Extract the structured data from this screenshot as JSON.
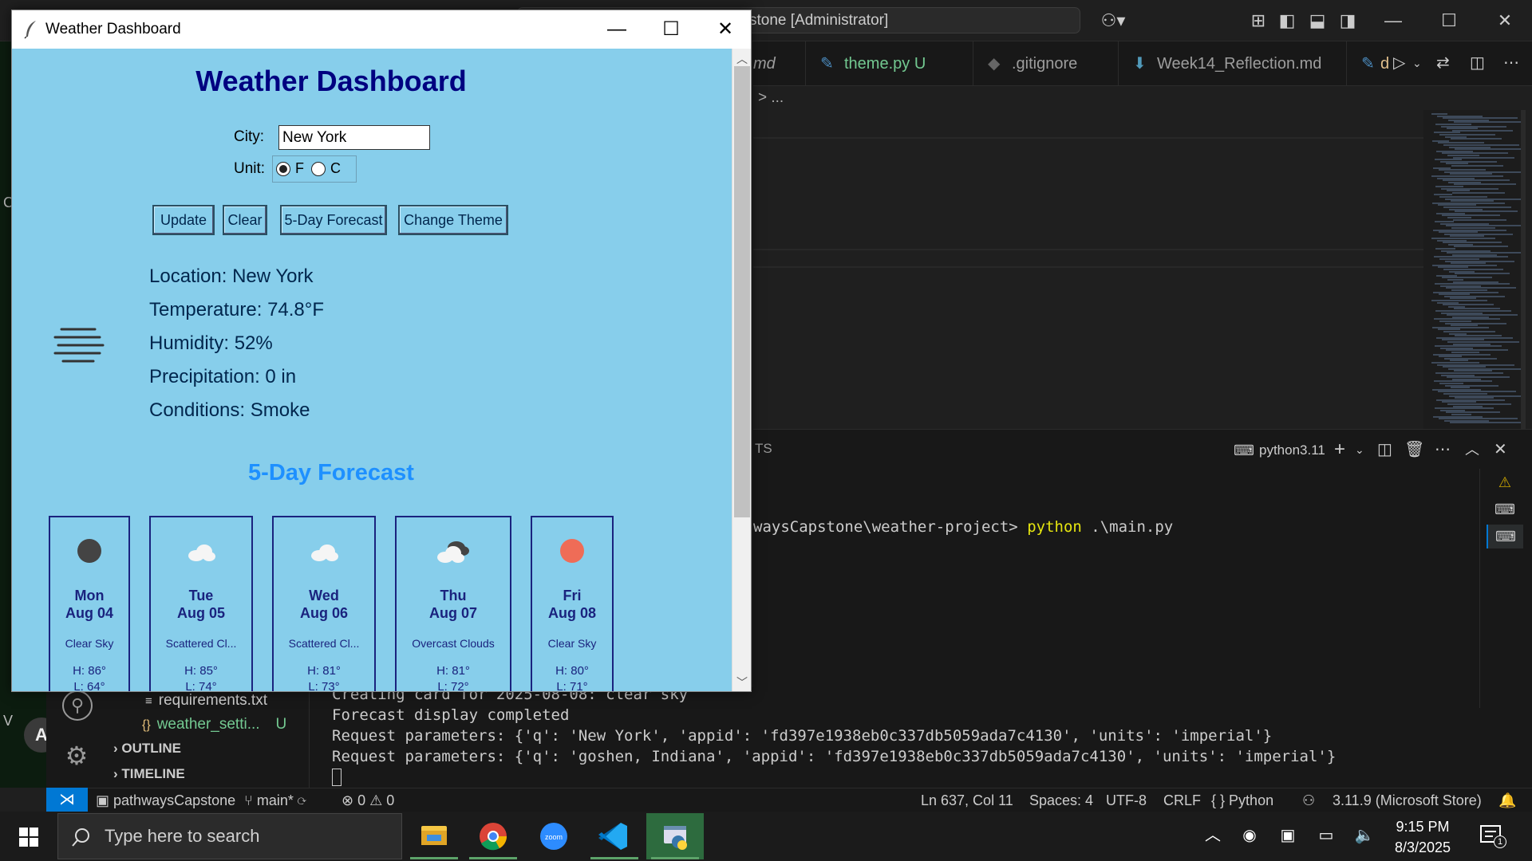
{
  "vscode": {
    "window_title": "stone [Administrator]",
    "tabs": [
      {
        "label": "md",
        "suffix": ""
      },
      {
        "label": "theme.py",
        "suffix": "U"
      },
      {
        "label": ".gitignore",
        "suffix": ""
      },
      {
        "label": "Week14_Reflection.md",
        "suffix": ""
      },
      {
        "label": "d",
        "suffix": ""
      }
    ],
    "breadcrumb": "> ...",
    "panel_tab": "TS",
    "terminal_name": "python3.11",
    "terminal": {
      "prompt_tail": "waysCapstone\\weather-project>",
      "command": "python",
      "command_arg": ".\\main.py",
      "lines": [
        "Creating card for 2025-08-08: clear sky",
        "Forecast display completed",
        "Request parameters: {'q': 'New York', 'appid': 'fd397e1938eb0c337db5059ada7c4130', 'units': 'imperial'}",
        "Request parameters: {'q': 'goshen, Indiana', 'appid': 'fd397e1938eb0c337db5059ada7c4130', 'units': 'imperial'}"
      ]
    },
    "explorer": {
      "files": [
        {
          "icon": "≡",
          "name": "requirements.txt",
          "status": ""
        },
        {
          "icon": "{}",
          "name": "weather_setti...",
          "status": "U"
        }
      ],
      "sections": [
        "OUTLINE",
        "TIMELINE"
      ]
    },
    "left_edge": {
      "top": "C",
      "bottom": "V",
      "badge": "A"
    },
    "statusbar": {
      "repo": "pathwaysCapstone",
      "branch": "main*",
      "errors": "0",
      "warnings": "0",
      "position": "Ln 637, Col 11",
      "spaces": "Spaces: 4",
      "encoding": "UTF-8",
      "eol": "CRLF",
      "language": "Python",
      "interpreter": "3.11.9 (Microsoft Store)"
    }
  },
  "taskbar": {
    "search_placeholder": "Type here to search",
    "time": "9:15 PM",
    "date": "8/3/2025",
    "notifications": "1"
  },
  "weather_window": {
    "title": "Weather Dashboard",
    "heading": "Weather Dashboard",
    "city_label": "City:",
    "city_value": "New York",
    "unit_label": "Unit:",
    "unit_options": [
      "F",
      "C"
    ],
    "unit_selected": "F",
    "buttons": {
      "update": "Update",
      "clear": "Clear",
      "forecast": "5-Day Forecast",
      "theme": "Change Theme"
    },
    "current": {
      "location": "Location: New York",
      "temperature": "Temperature: 74.8°F",
      "humidity": "Humidity: 52%",
      "precipitation": "Precipitation: 0 in",
      "conditions": "Conditions: Smoke"
    },
    "forecast_title": "5-Day Forecast",
    "forecast": [
      {
        "day": "Mon",
        "date": "Aug 04",
        "desc": "Clear Sky",
        "high": "H: 86°",
        "low": "L: 64°",
        "icon": "dark-sun-icon"
      },
      {
        "day": "Tue",
        "date": "Aug 05",
        "desc": "Scattered Cl...",
        "high": "H: 85°",
        "low": "L: 74°",
        "icon": "cloud-icon"
      },
      {
        "day": "Wed",
        "date": "Aug 06",
        "desc": "Scattered Cl...",
        "high": "H: 81°",
        "low": "L: 73°",
        "icon": "cloud-icon"
      },
      {
        "day": "Thu",
        "date": "Aug 07",
        "desc": "Overcast Clouds",
        "high": "H: 81°",
        "low": "L: 72°",
        "icon": "overcast-clouds-icon"
      },
      {
        "day": "Fri",
        "date": "Aug 08",
        "desc": "Clear Sky",
        "high": "H: 80°",
        "low": "L: 71°",
        "icon": "red-sun-icon"
      }
    ]
  }
}
